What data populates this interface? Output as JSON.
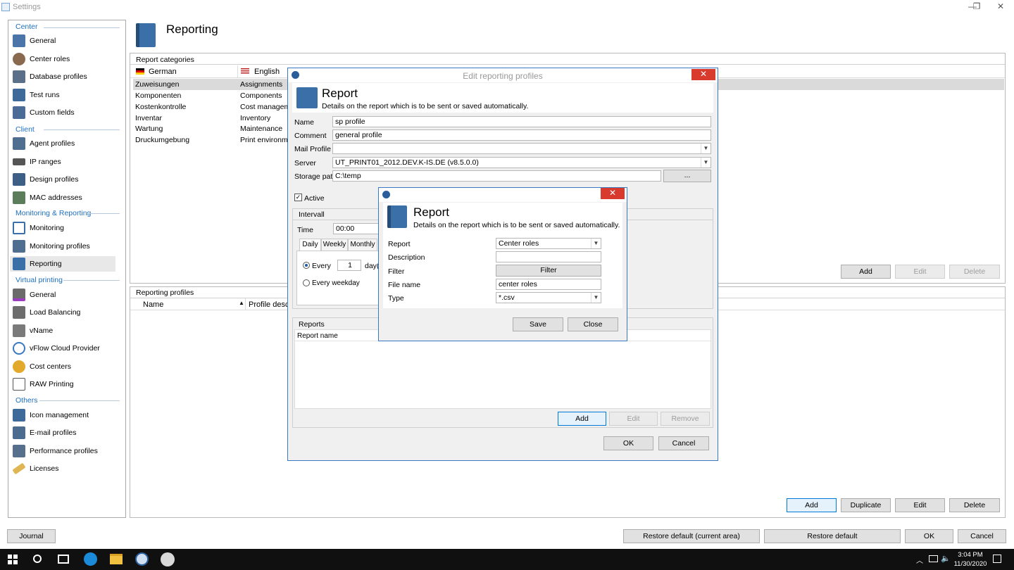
{
  "window": {
    "title": "Settings",
    "minimize": "—",
    "restore": "❐",
    "close": "✕"
  },
  "nav": {
    "sections": [
      {
        "label": "Center"
      },
      {
        "label": "Client"
      },
      {
        "label": "Monitoring & Reporting"
      },
      {
        "label": "Virtual printing"
      },
      {
        "label": "Others"
      }
    ],
    "items": [
      {
        "label": "General"
      },
      {
        "label": "Center roles"
      },
      {
        "label": "Database profiles"
      },
      {
        "label": "Test runs"
      },
      {
        "label": "Custom fields"
      },
      {
        "label": "Agent profiles"
      },
      {
        "label": "IP ranges"
      },
      {
        "label": "Design profiles"
      },
      {
        "label": "MAC addresses"
      },
      {
        "label": "Monitoring"
      },
      {
        "label": "Monitoring profiles"
      },
      {
        "label": "Reporting"
      },
      {
        "label": "General"
      },
      {
        "label": "Load Balancing"
      },
      {
        "label": "vName"
      },
      {
        "label": "vFlow Cloud Provider"
      },
      {
        "label": "Cost centers"
      },
      {
        "label": "RAW Printing"
      },
      {
        "label": "Icon management"
      },
      {
        "label": "E-mail profiles"
      },
      {
        "label": "Performance profiles"
      },
      {
        "label": "Licenses"
      }
    ]
  },
  "page": {
    "title": "Reporting"
  },
  "categories": {
    "header": "Report categories",
    "col_german": "German",
    "col_english": "English",
    "rows": [
      {
        "de": "Zuweisungen",
        "en": "Assignments"
      },
      {
        "de": "Komponenten",
        "en": "Components"
      },
      {
        "de": "Kostenkontrolle",
        "en": "Cost managemer"
      },
      {
        "de": "Inventar",
        "en": "Inventory"
      },
      {
        "de": "Wartung",
        "en": "Maintenance"
      },
      {
        "de": "Druckumgebung",
        "en": "Print environmer"
      }
    ],
    "add": "Add",
    "edit": "Edit",
    "delete": "Delete"
  },
  "profiles": {
    "header": "Reporting profiles",
    "col_name": "Name",
    "col_desc": "Profile descrip",
    "add": "Add",
    "duplicate": "Duplicate",
    "edit": "Edit",
    "delete": "Delete"
  },
  "edit_dialog": {
    "title": "Edit reporting profiles",
    "heading": "Report",
    "subheading": "Details on the report which is to be sent or saved automatically.",
    "name_label": "Name",
    "name_value": "sp profile",
    "comment_label": "Comment",
    "comment_value": "general profile",
    "mail_label": "Mail Profile",
    "mail_value": "",
    "server_label": "Server",
    "server_value": "UT_PRINT01_2012.DEV.K-IS.DE (v8.5.0.0)",
    "storage_label": "Storage path",
    "storage_value": "C:\\temp",
    "browse": "...",
    "active_label": "Active",
    "intervall_header": "Intervall",
    "time_label": "Time",
    "time_value": "00:00",
    "tabs": [
      {
        "label": "Daily"
      },
      {
        "label": "Weekly"
      },
      {
        "label": "Monthly"
      }
    ],
    "every_label": "Every",
    "every_value": "1",
    "days_label": "day(s",
    "every_weekday_label": "Every weekday",
    "reports_header": "Reports",
    "report_name_col": "Report name",
    "add": "Add",
    "edit": "Edit",
    "remove": "Remove",
    "ok": "OK",
    "cancel": "Cancel"
  },
  "report_dialog": {
    "heading": "Report",
    "subheading": "Details on the report which is to be sent or saved automatically.",
    "report_label": "Report",
    "report_value": "Center roles",
    "description_label": "Description",
    "description_value": "",
    "filter_label": "Filter",
    "filter_button": "Filter",
    "filename_label": "File name",
    "filename_value": "center roles",
    "type_label": "Type",
    "type_value": "*.csv",
    "save": "Save",
    "close": "Close"
  },
  "footer": {
    "journal": "Journal",
    "restore_area": "Restore default (current area)",
    "restore_default": "Restore default",
    "ok": "OK",
    "cancel": "Cancel"
  },
  "taskbar": {
    "time": "3:04 PM",
    "date": "11/30/2020"
  }
}
